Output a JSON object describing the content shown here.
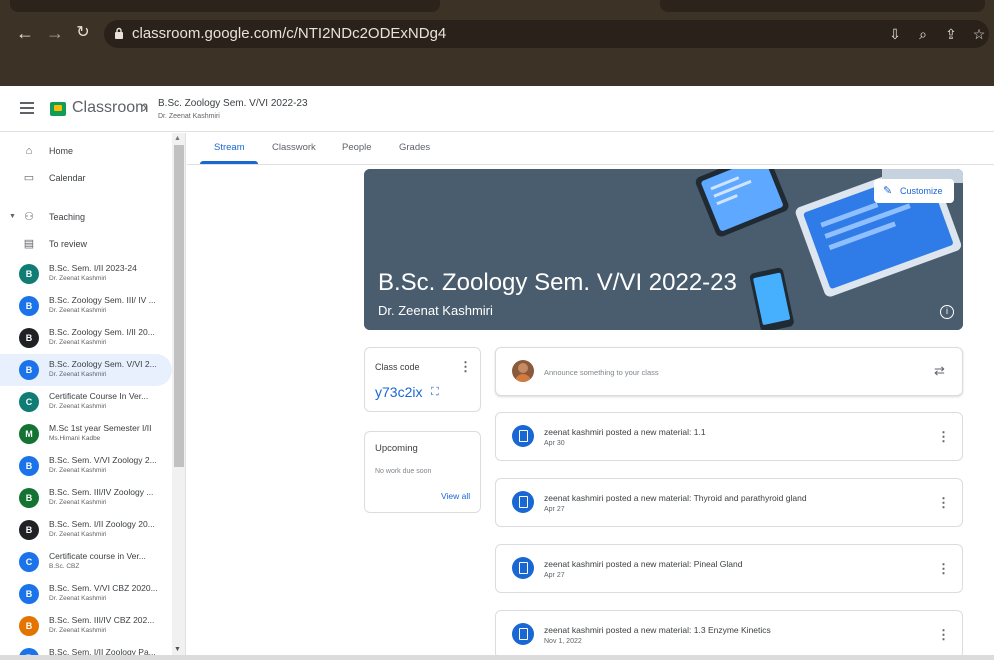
{
  "browser": {
    "url": "classroom.google.com/c/NTI2NDc2ODExNDg4"
  },
  "header": {
    "app_name": "Classroom",
    "breadcrumb_title": "B.Sc. Zoology Sem. V/VI 2022-23",
    "breadcrumb_sub": "Dr. Zeenat Kashmiri"
  },
  "sidebar": {
    "home": "Home",
    "calendar": "Calendar",
    "teaching": "Teaching",
    "to_review": "To review",
    "courses": [
      {
        "initial": "B",
        "title": "B.Sc. Sem. I/II 2023-24",
        "sub": "Dr. Zeenat Kashmiri",
        "color": "#0f7d74"
      },
      {
        "initial": "B",
        "title": "B.Sc. Zoology Sem. III/ IV ...",
        "sub": "Dr. Zeenat Kashmiri",
        "color": "#1a73e8"
      },
      {
        "initial": "B",
        "title": "B.Sc. Zoology Sem. I/II 20...",
        "sub": "Dr. Zeenat Kashmiri",
        "color": "#202124"
      },
      {
        "initial": "B",
        "title": "B.Sc. Zoology Sem. V/VI 2...",
        "sub": "Dr. Zeenat Kashmiri",
        "color": "#1a73e8"
      },
      {
        "initial": "C",
        "title": "Certificate Course In Ver...",
        "sub": "Dr. Zeenat Kashmiri",
        "color": "#0f7d74"
      },
      {
        "initial": "M",
        "title": "M.Sc 1st year Semester I/II",
        "sub": "Ms.Himani Kadbe",
        "color": "#137333"
      },
      {
        "initial": "B",
        "title": "B.Sc. Sem. V/VI Zoology 2...",
        "sub": "Dr. Zeenat Kashmiri",
        "color": "#1a73e8"
      },
      {
        "initial": "B",
        "title": "B.Sc. Sem. III/IV Zoology ...",
        "sub": "Dr. Zeenat Kashmiri",
        "color": "#137333"
      },
      {
        "initial": "B",
        "title": "B.Sc. Sem. I/II Zoology 20...",
        "sub": "Dr. Zeenat Kashmiri",
        "color": "#202124"
      },
      {
        "initial": "C",
        "title": "Certificate course in Ver...",
        "sub": "B.Sc. CBZ",
        "color": "#1a73e8"
      },
      {
        "initial": "B",
        "title": "B.Sc. Sem. V/VI CBZ 2020...",
        "sub": "Dr. Zeenat Kashmiri",
        "color": "#1a73e8"
      },
      {
        "initial": "B",
        "title": "B.Sc. Sem. III/IV CBZ 202...",
        "sub": "Dr. Zeenat Kashmiri",
        "color": "#e37400"
      },
      {
        "initial": "B",
        "title": "B.Sc. Sem. I/II Zoology Pa...",
        "sub": "",
        "color": "#1a73e8"
      }
    ]
  },
  "tabs": [
    "Stream",
    "Classwork",
    "People",
    "Grades"
  ],
  "banner": {
    "title": "B.Sc. Zoology Sem. V/VI 2022-23",
    "subtitle": "Dr. Zeenat Kashmiri",
    "customize": "Customize"
  },
  "class_code": {
    "label": "Class code",
    "value": "y73c2ix"
  },
  "upcoming": {
    "title": "Upcoming",
    "text": "No work due soon",
    "link": "View all"
  },
  "announce": {
    "placeholder": "Announce something to your class"
  },
  "posts": [
    {
      "title": "zeenat kashmiri posted a new material: 1.1",
      "date": "Apr 30"
    },
    {
      "title": "zeenat kashmiri posted a new material: Thyroid and parathyroid gland",
      "date": "Apr 27"
    },
    {
      "title": "zeenat kashmiri posted a new material: Pineal Gland",
      "date": "Apr 27"
    },
    {
      "title": "zeenat kashmiri posted a new material: 1.3 Enzyme Kinetics",
      "date": "Nov 1, 2022"
    }
  ]
}
